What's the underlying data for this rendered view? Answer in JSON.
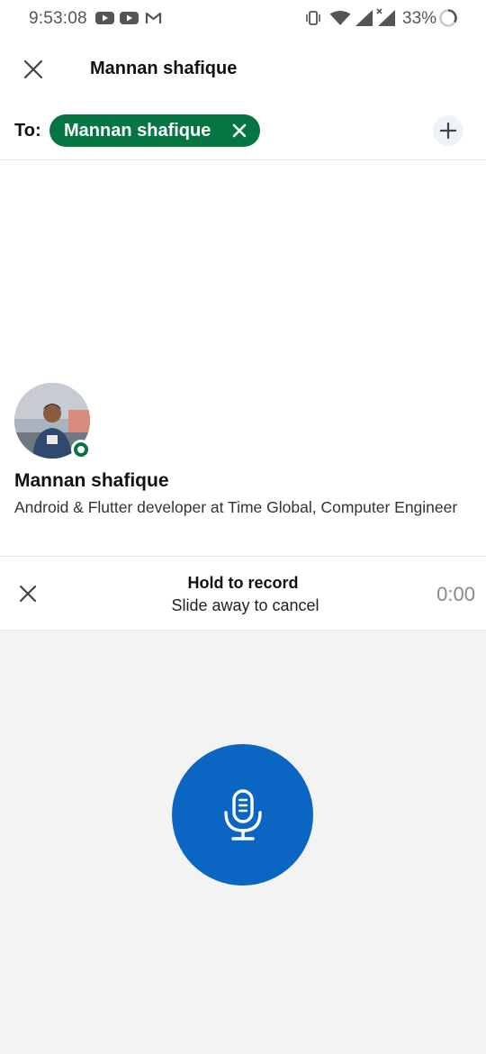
{
  "status_bar": {
    "time": "9:53:08",
    "battery": "33%",
    "icons": [
      "youtube-icon",
      "youtube-icon",
      "gmail-icon",
      "vibrate-icon",
      "wifi-icon",
      "signal-icon",
      "signal-icon",
      "battery-icon"
    ]
  },
  "header": {
    "title": "Mannan shafique"
  },
  "recipients": {
    "to_label": "To:",
    "chips": [
      {
        "label": "Mannan shafique"
      }
    ]
  },
  "profile": {
    "name": "Mannan shafique",
    "headline": "Android & Flutter developer at Time Global, Computer Engineer"
  },
  "recorder": {
    "title": "Hold to record",
    "subtitle": "Slide away to cancel",
    "timer": "0:00"
  },
  "colors": {
    "chip_green": "#057642",
    "mic_blue": "#0a66c2",
    "record_area_bg": "#f3f3f3"
  }
}
